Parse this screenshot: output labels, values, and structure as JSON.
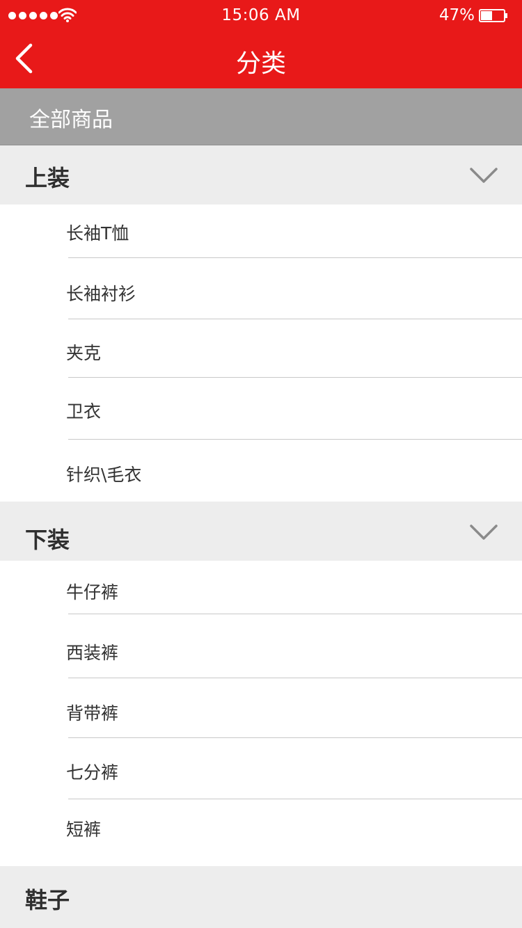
{
  "status_bar": {
    "time": "15:06 AM",
    "battery": "47%"
  },
  "nav": {
    "title": "分类"
  },
  "all_products": "全部商品",
  "sections": [
    {
      "title": "上装",
      "items": [
        "长袖T恤",
        "长袖衬衫",
        "夹克",
        "卫衣",
        "针织\\毛衣"
      ]
    },
    {
      "title": "下装",
      "items": [
        "牛仔裤",
        "西装裤",
        "背带裤",
        "七分裤",
        "短裤"
      ]
    },
    {
      "title": "鞋子"
    }
  ],
  "colors": {
    "nav_background": "#e81919",
    "all_bar": "#a1a1a1",
    "section_background": "#ededed"
  },
  "icons": {
    "back": "chevron-left-icon",
    "expand": "chevron-down-icon"
  }
}
